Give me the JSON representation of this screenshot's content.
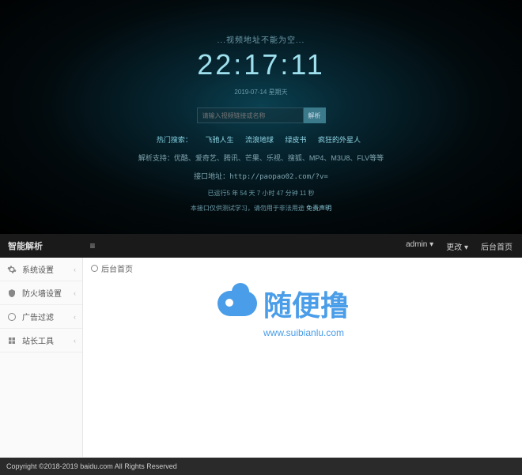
{
  "top": {
    "blur_text": "...视频地址不能为空...",
    "clock": "22:17:11",
    "date": "2019-07-14 星期天",
    "input_placeholder": "请输入视频链接或名称",
    "parse_button": "解析",
    "hot_search_label": "热门搜索：",
    "hot_links": [
      "飞驰人生",
      "流浪地球",
      "绿皮书",
      "疯狂的外星人"
    ],
    "support_label": "解析支持：",
    "support_text": "优酷、爱奇艺、腾讯、芒果、乐视、搜狐、MP4、M3U8、FLV等等",
    "api_label": "接口地址：",
    "api_url": "http://paopao02.com/?v=",
    "runtime": "已运行5 年 54 天 7 小时 47 分钟 11 秒",
    "disclaimer_text": "本接口仅供测试学习，请勿用于非法用途",
    "disclaimer_link": "免责声明"
  },
  "admin": {
    "title": "智能解析",
    "header_user": "admin",
    "header_menu": "更改",
    "header_home": "后台首页",
    "sidebar": {
      "items": [
        {
          "icon": "gear",
          "label": "系统设置"
        },
        {
          "icon": "shield",
          "label": "防火墙设置"
        },
        {
          "icon": "filter",
          "label": "广告过滤"
        },
        {
          "icon": "tools",
          "label": "站长工具"
        }
      ]
    },
    "breadcrumb": "后台首页",
    "footer": "Copyright ©2018-2019 baidu.com All Rights Reserved"
  },
  "watermark": {
    "title": "随便撸",
    "url": "www.suibianlu.com"
  }
}
